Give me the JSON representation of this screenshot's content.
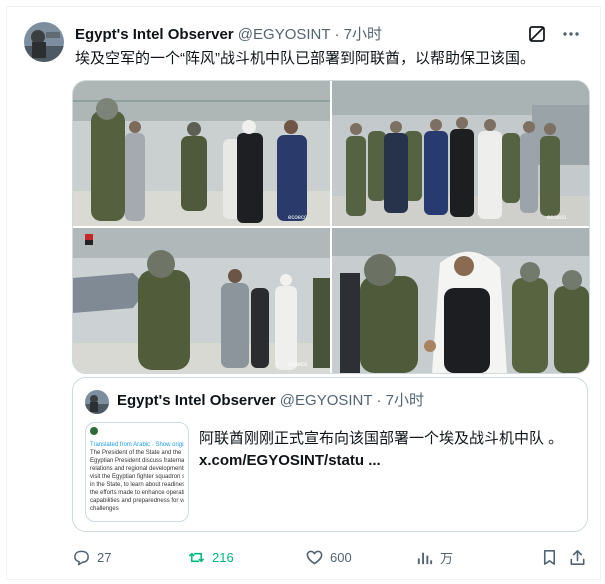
{
  "tweet": {
    "display_name": "Egypt's Intel Observer",
    "handle": "@EGYOSINT",
    "separator": "·",
    "time": "7小时",
    "text": "埃及空军的一个“阵风”战斗机中队已部署到阿联酋，以帮助保卫该国。"
  },
  "header_icons": [
    "grok-icon",
    "more-icon"
  ],
  "media": {
    "watermark": "ecoeco",
    "photos": [
      "group-inspection",
      "squadron-group-photo",
      "pilots-lineup",
      "handshake"
    ]
  },
  "quoted_tweet": {
    "display_name": "Egypt's Intel Observer",
    "handle": "@EGYOSINT",
    "separator": "·",
    "time": "7小时",
    "text": "阿联酋刚刚正式宣布向该国部署一个埃及战斗机中队 。",
    "link": "x.com/EGYOSINT/statu ...",
    "thumbnail_lines": [
      "Translated from Arabic · Show original",
      "The President of the State and the",
      "Egyptian President discuss fraternal",
      "relations and regional developments, and",
      "visit the Egyptian fighter squadron station",
      "in the State, to learn about readiness and",
      "the efforts made to enhance operational",
      "capabilities and preparedness for various",
      "challenges"
    ]
  },
  "actions": {
    "replies": "27",
    "reposts": "216",
    "likes": "600",
    "views": "万",
    "repost_color": "#00ba7c"
  }
}
